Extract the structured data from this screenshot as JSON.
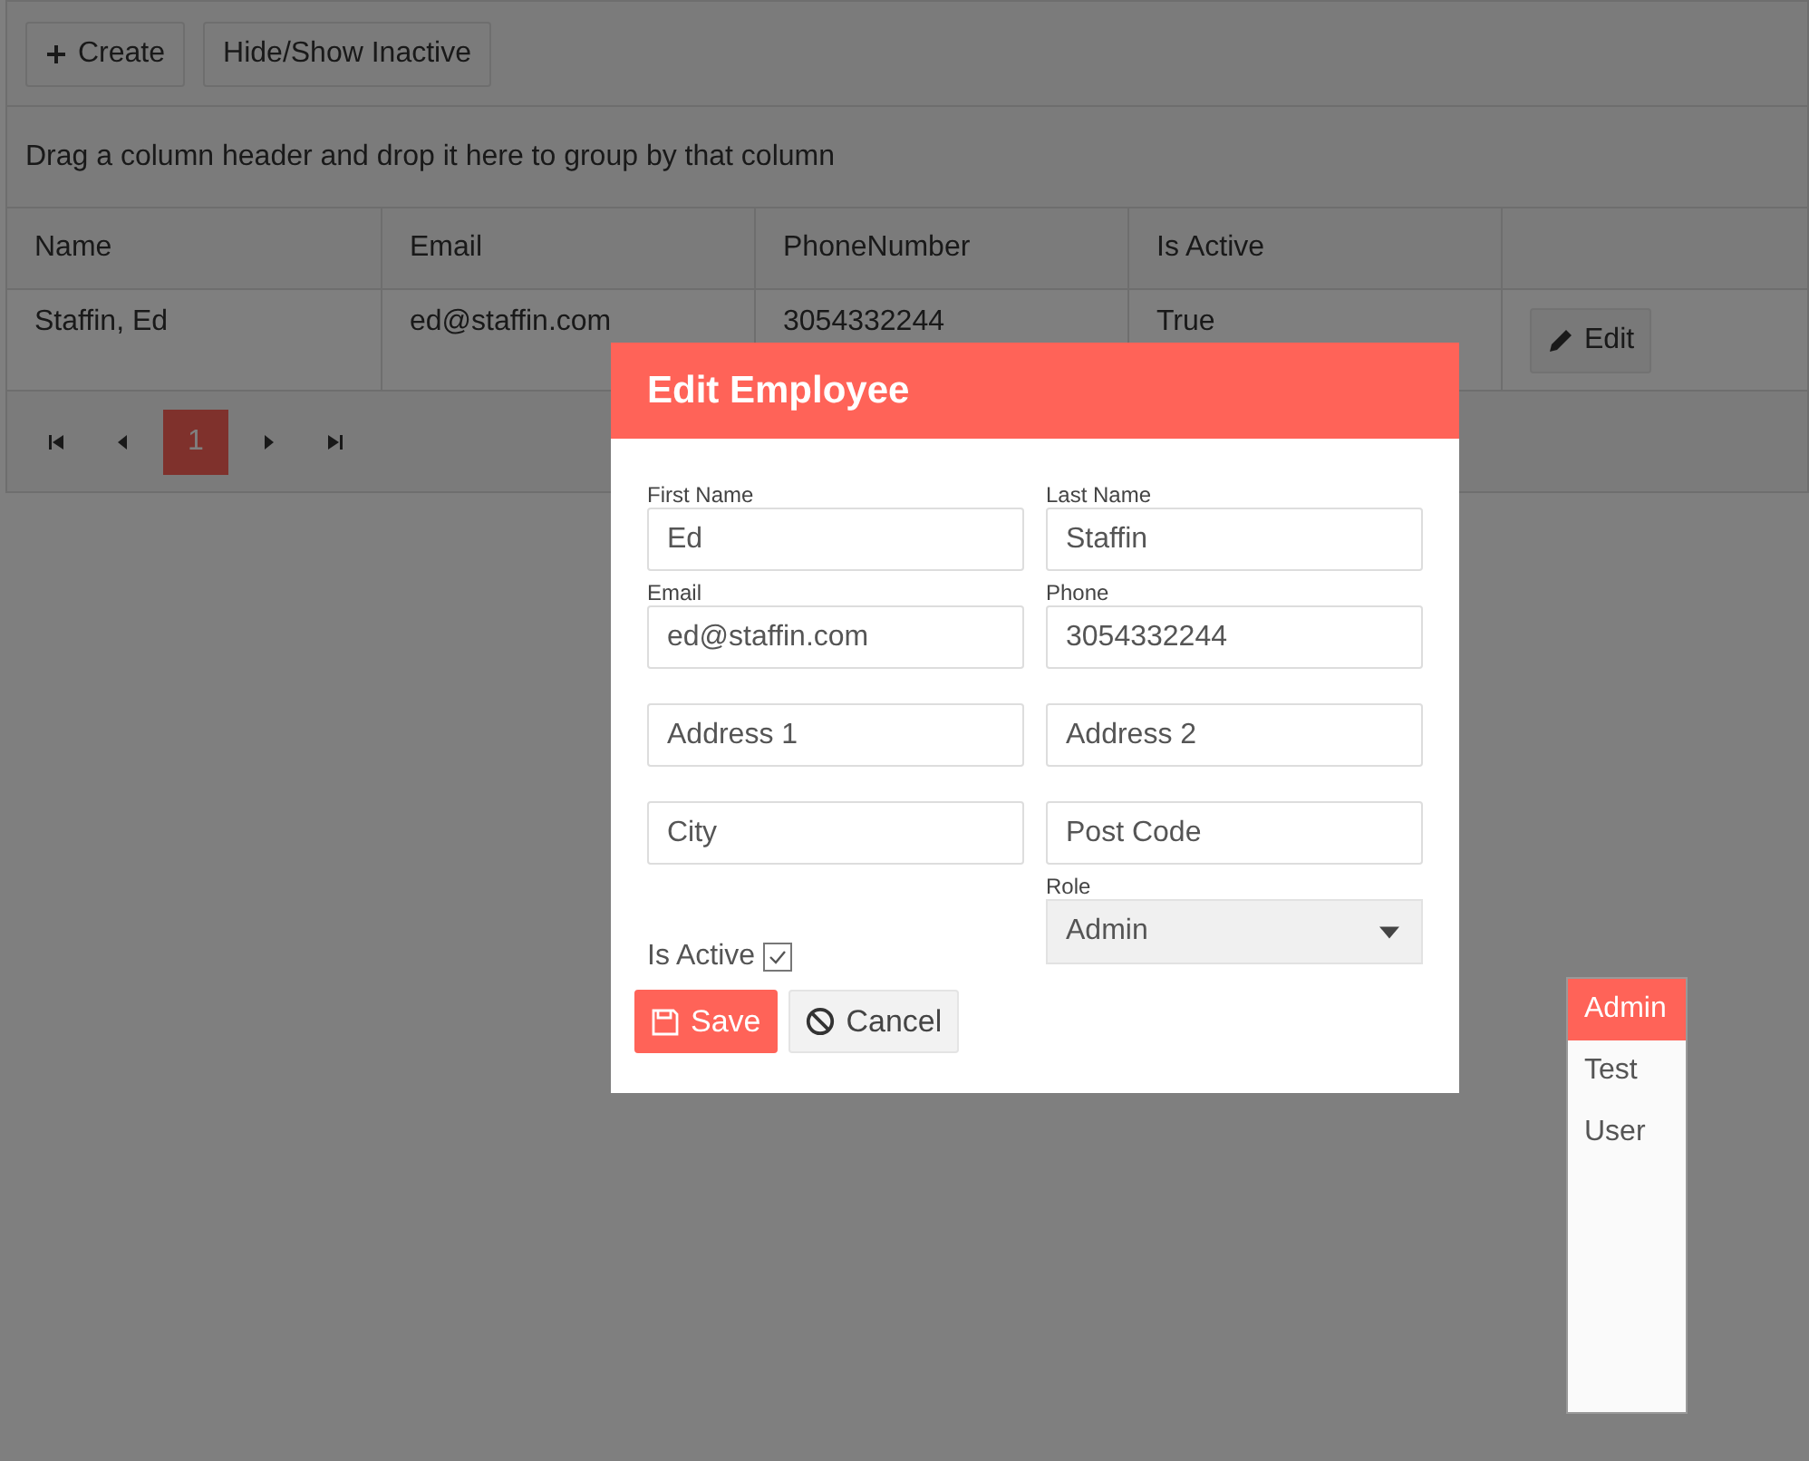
{
  "toolbar": {
    "buttons": [
      {
        "kind": "create",
        "label": "Create"
      },
      {
        "kind": "plain",
        "label": "Hide/Show Inactive"
      }
    ]
  },
  "group_hint": "Drag a column header and drop it here to group by that column",
  "table": {
    "columns": [
      "Name",
      "Email",
      "PhoneNumber",
      "Is Active"
    ],
    "rows": [
      {
        "cells": [
          "Staffin, Ed",
          "ed@staffin.com",
          "3054332244",
          "True"
        ],
        "action": "Edit"
      }
    ]
  },
  "pager": {
    "pages": [
      {
        "label": "1",
        "selected": true
      }
    ]
  },
  "dialog": {
    "title": "Edit Employee",
    "fields": [
      {
        "label": "First Name",
        "value": "Ed"
      },
      {
        "label": "Last Name",
        "value": "Staffin"
      },
      {
        "label": "Email",
        "value": "ed@staffin.com"
      },
      {
        "label": "Phone",
        "value": "3054332244"
      },
      {
        "placeholder": "Address 1"
      },
      {
        "placeholder": "Address 2"
      },
      {
        "placeholder": "City"
      },
      {
        "placeholder": "Post Code"
      }
    ],
    "is_active": {
      "label": "Is Active",
      "checked": true
    },
    "role": {
      "label": "Role",
      "value": "Admin"
    },
    "buttons": [
      {
        "kind": "save",
        "label": "Save"
      },
      {
        "kind": "cancel",
        "label": "Cancel"
      }
    ]
  },
  "role_options": [
    {
      "label": "Admin",
      "selected": true
    },
    {
      "label": "Test",
      "selected": false
    },
    {
      "label": "User",
      "selected": false
    }
  ]
}
